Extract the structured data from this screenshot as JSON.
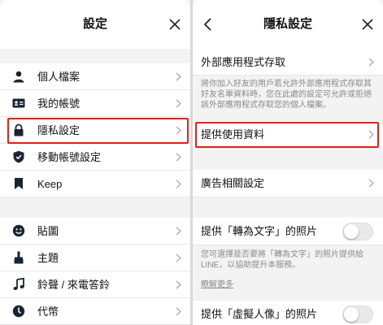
{
  "left": {
    "title": "設定",
    "items": [
      {
        "label": "個人檔案",
        "icon": "person-icon"
      },
      {
        "label": "我的帳號",
        "icon": "id-card-icon"
      },
      {
        "label": "隱私設定",
        "icon": "lock-icon"
      },
      {
        "label": "移動帳號設定",
        "icon": "shield-icon"
      },
      {
        "label": "Keep",
        "icon": "bookmark-icon"
      },
      {
        "label": "貼圖",
        "icon": "smiley-icon"
      },
      {
        "label": "主題",
        "icon": "brush-icon"
      },
      {
        "label": "鈴聲 / 來電答鈴",
        "icon": "music-note-icon"
      },
      {
        "label": "代幣",
        "icon": "coin-icon"
      }
    ]
  },
  "right": {
    "title": "隱私設定",
    "external_access": "外部應用程式存取",
    "external_desc": "將你加入好友的用戶若允許外部應用程式存取其好友名單資料時，您在此處的設定可允許或拒絕該外部應用程式存取您的個人檔案。",
    "provide_data": "提供使用資料",
    "ad_settings": "廣告相關設定",
    "text_photos": "提供「轉為文字」的照片",
    "text_photos_desc": "您可選擇是否要將「轉為文字」的照片提供給LINE，以協助提升本服務。",
    "learn_more": "瞭解更多",
    "avatar_photos": "提供「虛擬人像」的照片"
  },
  "colors": {
    "highlight": "#e0211b",
    "icon": "#1b2433"
  }
}
